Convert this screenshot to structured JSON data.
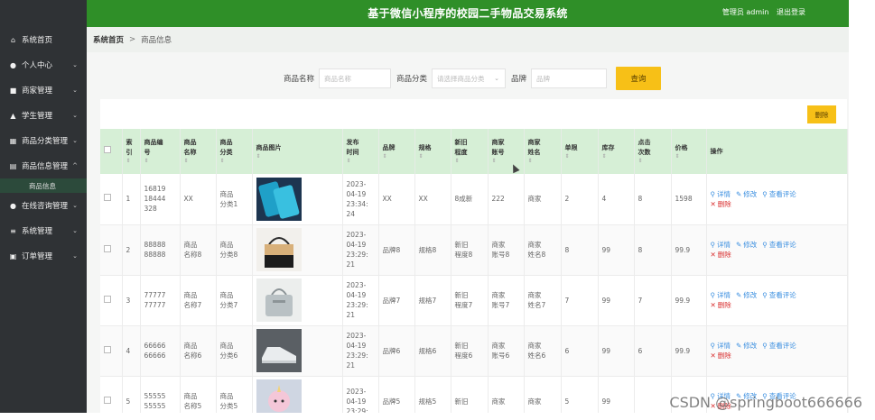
{
  "header": {
    "title": "基于微信小程序的校园二手物品交易系统",
    "role": "管理员 admin",
    "logout": "退出登录",
    "bg_color": "#2f8f28"
  },
  "sidebar": {
    "items": [
      {
        "label": "系统首页",
        "icon": "home-icon",
        "glyph": "⌂",
        "has_arrow": false
      },
      {
        "label": "个人中心",
        "icon": "person-icon",
        "glyph": "●",
        "has_arrow": true
      },
      {
        "label": "商家管理",
        "icon": "store-icon",
        "glyph": "■",
        "has_arrow": true
      },
      {
        "label": "学生管理",
        "icon": "student-icon",
        "glyph": "▲",
        "has_arrow": true
      },
      {
        "label": "商品分类管理",
        "icon": "grid-icon",
        "glyph": "▦",
        "has_arrow": true
      },
      {
        "label": "商品信息管理",
        "icon": "doc-icon",
        "glyph": "▤",
        "has_arrow": true,
        "expanded": true,
        "children": [
          "商品信息"
        ]
      },
      {
        "label": "在线咨询管理",
        "icon": "chat-icon",
        "glyph": "●",
        "has_arrow": true
      },
      {
        "label": "系统管理",
        "icon": "settings-icon",
        "glyph": "≡",
        "has_arrow": true
      },
      {
        "label": "订单管理",
        "icon": "order-icon",
        "glyph": "▣",
        "has_arrow": true
      }
    ]
  },
  "breadcrumb": {
    "home": "系统首页",
    "separator": ">",
    "current": "商品信息"
  },
  "search": {
    "name_label": "商品名称",
    "name_placeholder": "商品名称",
    "category_label": "商品分类",
    "category_placeholder": "请选择商品分类",
    "brand_label": "品牌",
    "brand_placeholder": "品牌",
    "query_button": "查询"
  },
  "toolbar": {
    "delete_button": "删除"
  },
  "table": {
    "columns": [
      "索引",
      "商品编号",
      "商品名称",
      "商品分类",
      "商品图片",
      "发布时间",
      "品牌",
      "规格",
      "新旧程度",
      "商家账号",
      "商家姓名",
      "单限",
      "库存",
      "点击次数",
      "价格",
      "操作"
    ],
    "column_display": [
      "索\n引",
      "商品编\n号",
      "商品\n名称",
      "商品\n分类",
      "商品图片",
      "发布\n时间",
      "品牌",
      "规格",
      "新旧\n程度",
      "商家\n账号",
      "商家\n姓名",
      "单限",
      "库存",
      "点击\n次数",
      "价格",
      "操作"
    ],
    "rows": [
      {
        "index": "1",
        "code": "16819\n18444\n328",
        "name": "XX",
        "category": "商品\n分类1",
        "time": "2023-\n04-19\n23:34:\n24",
        "brand": "XX",
        "spec": "XX",
        "condition": "8成新",
        "account": "222",
        "merchant": "商家",
        "limit": "2",
        "stock": "4",
        "clicks": "8",
        "price": "1598",
        "img": "phone"
      },
      {
        "index": "2",
        "code": "88888\n88888",
        "name": "商品\n名称8",
        "category": "商品\n分类8",
        "time": "2023-\n04-19\n23:29:\n21",
        "brand": "品牌8",
        "spec": "规格8",
        "condition": "新旧\n程度8",
        "account": "商家\n账号8",
        "merchant": "商家\n姓名8",
        "limit": "8",
        "stock": "99",
        "clicks": "8",
        "price": "99.9",
        "img": "bag"
      },
      {
        "index": "3",
        "code": "77777\n77777",
        "name": "商品\n名称7",
        "category": "商品\n分类7",
        "time": "2023-\n04-19\n23:29:\n21",
        "brand": "品牌7",
        "spec": "规格7",
        "condition": "新旧\n程度7",
        "account": "商家\n账号7",
        "merchant": "商家\n姓名7",
        "limit": "7",
        "stock": "99",
        "clicks": "7",
        "price": "99.9",
        "img": "handbag"
      },
      {
        "index": "4",
        "code": "66666\n66666",
        "name": "商品\n名称6",
        "category": "商品\n分类6",
        "time": "2023-\n04-19\n23:29:\n21",
        "brand": "品牌6",
        "spec": "规格6",
        "condition": "新旧\n程度6",
        "account": "商家\n账号6",
        "merchant": "商家\n姓名6",
        "limit": "6",
        "stock": "99",
        "clicks": "6",
        "price": "99.9",
        "img": "shoe"
      },
      {
        "index": "5",
        "code": "55555\n55555",
        "name": "商品\n名称5",
        "category": "商品\n分类5",
        "time": "2023-\n04-19\n23:29:",
        "brand": "品牌5",
        "spec": "规格5",
        "condition": "新旧",
        "account": "商家",
        "merchant": "商家",
        "limit": "5",
        "stock": "99",
        "clicks": "",
        "price": "",
        "img": "toy"
      }
    ],
    "actions": {
      "detail": "详情",
      "edit": "修改",
      "review": "查看评论",
      "delete": "删除"
    }
  },
  "watermark": "CSDN @springboot666666"
}
